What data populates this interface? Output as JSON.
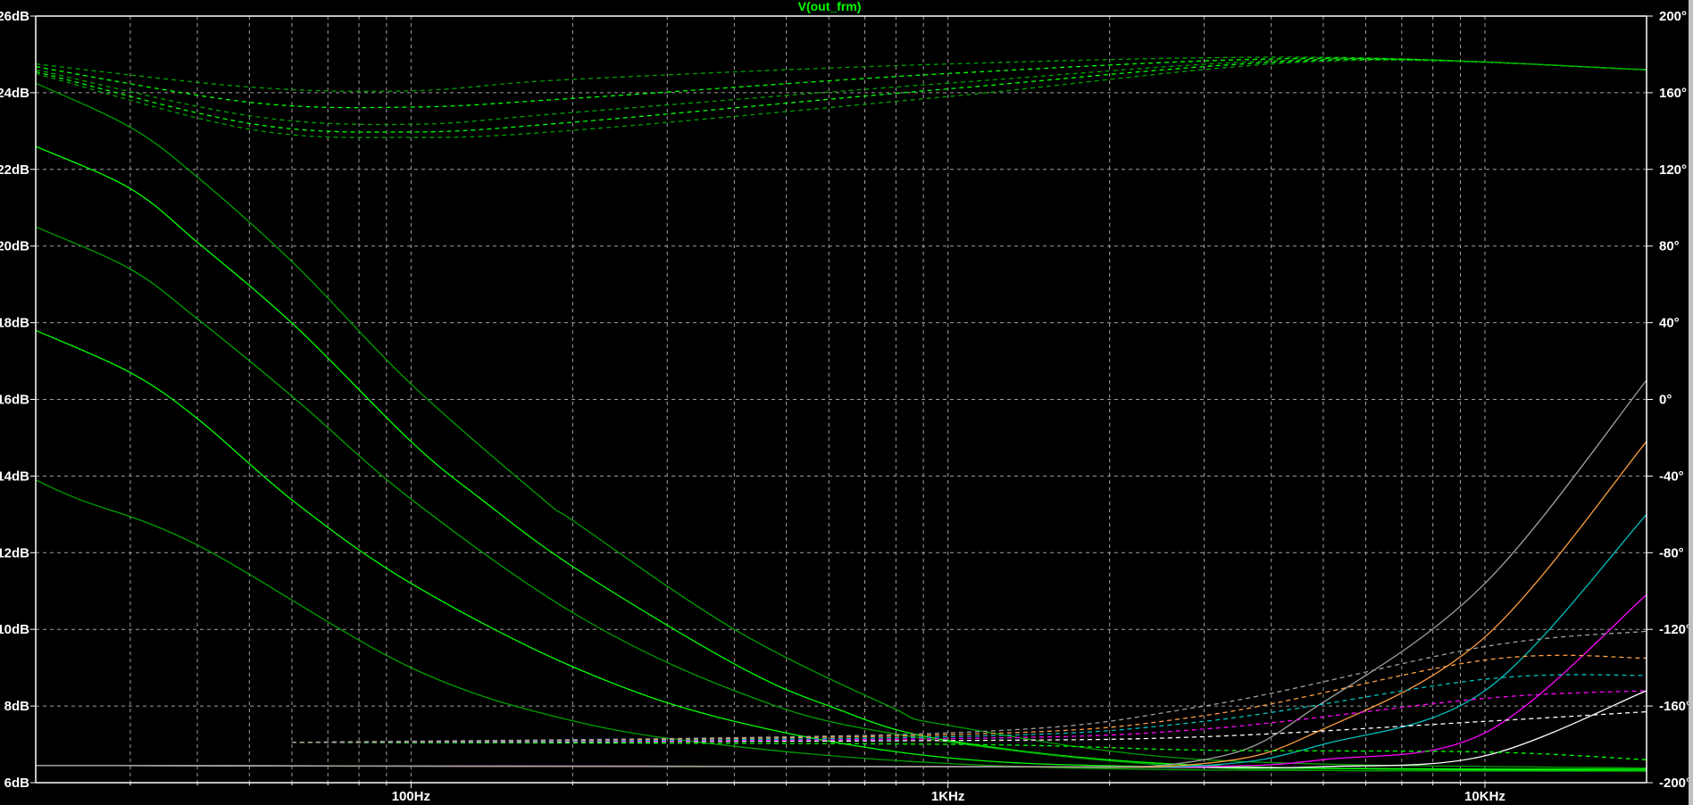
{
  "chart_data": {
    "type": "line",
    "title": "V(out_frm)",
    "title_color": "#00ff00",
    "xscale": "log",
    "xlim": [
      20,
      20000
    ],
    "xlabel": "",
    "x_tick_labels": [
      {
        "value": 100,
        "label": "100Hz"
      },
      {
        "value": 1000,
        "label": "1KHz"
      },
      {
        "value": 10000,
        "label": "10KHz"
      }
    ],
    "ylim_left": [
      6,
      26
    ],
    "ylabel_left": "dB",
    "y_ticks_left": [
      {
        "value": 26,
        "label": "26dB"
      },
      {
        "value": 24,
        "label": "24dB"
      },
      {
        "value": 22,
        "label": "22dB"
      },
      {
        "value": 20,
        "label": "20dB"
      },
      {
        "value": 18,
        "label": "18dB"
      },
      {
        "value": 16,
        "label": "16dB"
      },
      {
        "value": 14,
        "label": "14dB"
      },
      {
        "value": 12,
        "label": "12dB"
      },
      {
        "value": 10,
        "label": "10dB"
      },
      {
        "value": 8,
        "label": "8dB"
      },
      {
        "value": 6,
        "label": "6dB"
      }
    ],
    "ylim_right": [
      -200,
      200
    ],
    "ylabel_right": "degrees",
    "y_ticks_right": [
      {
        "value": 200,
        "label": "200°"
      },
      {
        "value": 160,
        "label": "160°"
      },
      {
        "value": 120,
        "label": "120°"
      },
      {
        "value": 80,
        "label": "80°"
      },
      {
        "value": 40,
        "label": "40°"
      },
      {
        "value": 0,
        "label": "0°"
      },
      {
        "value": -40,
        "label": "-40°"
      },
      {
        "value": -80,
        "label": "-80°"
      },
      {
        "value": -120,
        "label": "-120°"
      },
      {
        "value": -160,
        "label": "-160°"
      },
      {
        "value": -200,
        "label": "-200°"
      }
    ],
    "grid": true,
    "series": [
      {
        "name": "mag-1",
        "kind": "magnitude",
        "axis": "left",
        "color": "#00a000",
        "x": [
          20,
          30,
          40,
          61,
          100,
          176,
          202,
          400,
          776,
          1000,
          3000,
          20000
        ],
        "y": [
          24.25,
          23.1,
          21.8,
          19.5,
          16.4,
          13.4,
          12.8,
          10.0,
          8.0,
          7.5,
          6.6,
          6.38
        ]
      },
      {
        "name": "mag-2",
        "kind": "magnitude",
        "axis": "left",
        "color": "#00ff00",
        "x": [
          20,
          30,
          40,
          61,
          100,
          135,
          202,
          400,
          601,
          1000,
          3000,
          20000
        ],
        "y": [
          22.6,
          21.5,
          20.1,
          17.9,
          14.9,
          13.4,
          11.6,
          9.1,
          8.0,
          7.1,
          6.45,
          6.35
        ]
      },
      {
        "name": "mag-3",
        "kind": "magnitude",
        "axis": "left",
        "color": "#00a000",
        "x": [
          20,
          30,
          40,
          61,
          100,
          202,
          400,
          776,
          3000,
          20000
        ],
        "y": [
          20.5,
          19.4,
          18.1,
          16.0,
          13.4,
          10.4,
          8.4,
          7.3,
          6.4,
          6.33
        ]
      },
      {
        "name": "mag-4",
        "kind": "magnitude",
        "axis": "left",
        "color": "#00ff00",
        "x": [
          20,
          30,
          40,
          61,
          100,
          202,
          400,
          1000,
          3000,
          20000
        ],
        "y": [
          17.8,
          16.7,
          15.5,
          13.3,
          11.2,
          9.0,
          7.6,
          6.65,
          6.4,
          6.32
        ]
      },
      {
        "name": "mag-5",
        "kind": "magnitude",
        "axis": "left",
        "color": "#00a000",
        "x": [
          20,
          24,
          40,
          100,
          202,
          400,
          1000,
          3000,
          20000
        ],
        "y": [
          13.9,
          13.4,
          12.2,
          9.0,
          7.6,
          6.95,
          6.5,
          6.33,
          6.3
        ]
      },
      {
        "name": "mag-white",
        "kind": "magnitude",
        "axis": "left",
        "color": "#ffffff",
        "x": [
          20,
          1000,
          3000,
          5000,
          10000,
          20000
        ],
        "y": [
          6.45,
          6.42,
          6.4,
          6.42,
          6.7,
          8.4
        ]
      },
      {
        "name": "mag-magenta",
        "kind": "magnitude",
        "axis": "left",
        "color": "#ff00ff",
        "x": [
          20,
          1000,
          3000,
          5000,
          10000,
          20000
        ],
        "y": [
          6.45,
          6.42,
          6.42,
          6.6,
          7.3,
          10.9
        ]
      },
      {
        "name": "mag-cyan",
        "kind": "magnitude",
        "axis": "left",
        "color": "#00c0c0",
        "x": [
          20,
          1000,
          3000,
          5000,
          10000,
          20000
        ],
        "y": [
          6.45,
          6.42,
          6.45,
          7.0,
          8.4,
          13.0
        ]
      },
      {
        "name": "mag-orange",
        "kind": "magnitude",
        "axis": "left",
        "color": "#ffa040",
        "x": [
          20,
          1000,
          3000,
          5000,
          10000,
          20000
        ],
        "y": [
          6.45,
          6.42,
          6.5,
          7.4,
          9.8,
          14.9
        ]
      },
      {
        "name": "mag-gray",
        "kind": "magnitude",
        "axis": "left",
        "color": "#a0a0a0",
        "x": [
          20,
          1000,
          3000,
          5000,
          10000,
          20000
        ],
        "y": [
          6.45,
          6.42,
          6.6,
          8.1,
          11.2,
          16.5
        ]
      },
      {
        "name": "phase-1",
        "kind": "phase",
        "axis": "right",
        "color": "#00a000",
        "x": [
          20,
          50,
          100,
          200,
          1000,
          5000,
          20000
        ],
        "y": [
          175,
          163,
          161,
          167,
          175,
          178.5,
          172
        ]
      },
      {
        "name": "phase-2",
        "kind": "phase",
        "axis": "right",
        "color": "#00ff00",
        "x": [
          20,
          50,
          100,
          200,
          1000,
          5000,
          20000
        ],
        "y": [
          173.6,
          155,
          152.5,
          157,
          170,
          178,
          172
        ]
      },
      {
        "name": "phase-3",
        "kind": "phase",
        "axis": "right",
        "color": "#00a000",
        "x": [
          20,
          50,
          100,
          200,
          1000,
          5000,
          20000
        ],
        "y": [
          172,
          148,
          143.5,
          149.7,
          165,
          177.5,
          172
        ]
      },
      {
        "name": "phase-4",
        "kind": "phase",
        "axis": "right",
        "color": "#00ff00",
        "x": [
          20,
          50,
          100,
          200,
          1000,
          5000,
          20000
        ],
        "y": [
          171,
          144,
          139.5,
          144.6,
          162,
          177,
          172
        ]
      },
      {
        "name": "phase-5",
        "kind": "phase",
        "axis": "right",
        "color": "#00a000",
        "x": [
          20,
          50,
          100,
          200,
          1000,
          5000,
          20000
        ],
        "y": [
          170,
          141,
          136.7,
          140.4,
          158,
          176.5,
          172
        ]
      },
      {
        "name": "phase-green-low",
        "kind": "phase",
        "axis": "right",
        "color": "#00ff00",
        "x": [
          60,
          1000,
          3000,
          10000,
          20000
        ],
        "y": [
          -179,
          -180,
          -183,
          -184,
          -188
        ]
      },
      {
        "name": "phase-white",
        "kind": "phase",
        "axis": "right",
        "color": "#ffffff",
        "x": [
          60,
          1000,
          3000,
          10000,
          20000
        ],
        "y": [
          -179,
          -178,
          -176,
          -168,
          -163
        ]
      },
      {
        "name": "phase-magenta",
        "kind": "phase",
        "axis": "right",
        "color": "#ff00ff",
        "x": [
          60,
          1000,
          3000,
          10000,
          20000
        ],
        "y": [
          -179,
          -177,
          -172,
          -156,
          -152
        ]
      },
      {
        "name": "phase-cyan",
        "kind": "phase",
        "axis": "right",
        "color": "#00c0c0",
        "x": [
          60,
          1000,
          3000,
          10000,
          20000
        ],
        "y": [
          -179,
          -176,
          -168,
          -146,
          -144
        ]
      },
      {
        "name": "phase-orange",
        "kind": "phase",
        "axis": "right",
        "color": "#ffa040",
        "x": [
          60,
          1000,
          3000,
          10000,
          20000
        ],
        "y": [
          -179,
          -175,
          -165,
          -136,
          -135
        ]
      },
      {
        "name": "phase-gray",
        "kind": "phase",
        "axis": "right",
        "color": "#a0a0a0",
        "x": [
          60,
          1000,
          3000,
          10000,
          20000
        ],
        "y": [
          -179,
          -174,
          -160,
          -129,
          -121
        ]
      }
    ]
  }
}
